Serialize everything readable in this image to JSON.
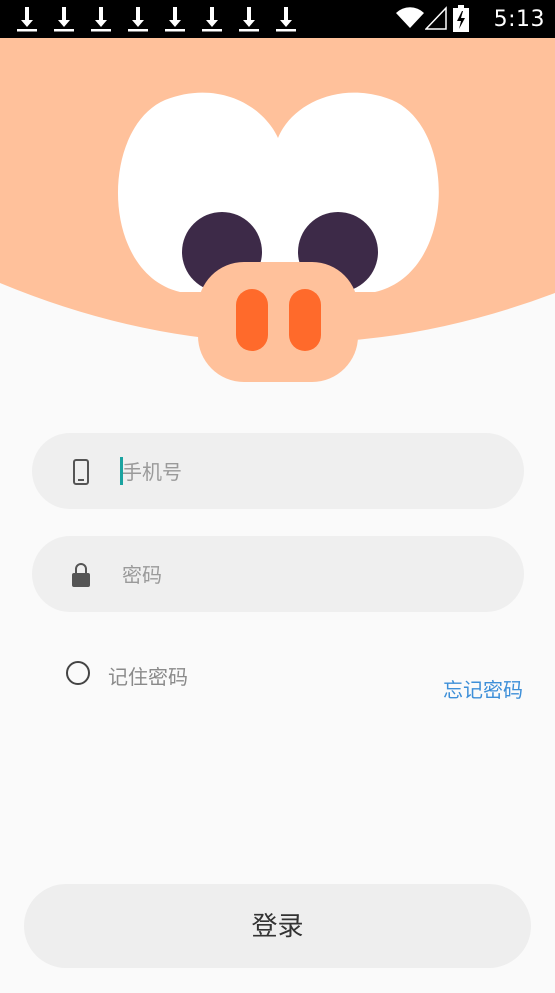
{
  "status_bar": {
    "time": "5:13",
    "download_icon_count": 8,
    "icons": [
      "download-icon",
      "wifi-icon",
      "signal-icon",
      "battery-icon"
    ]
  },
  "hero": {
    "icon": "pig-face-illustration",
    "colors": {
      "face": "#ffc19b",
      "eyes_white": "#ffffff",
      "pupil": "#3d2a48",
      "snout": "#ffc19b",
      "nostril": "#ff6a2b"
    }
  },
  "form": {
    "phone": {
      "icon": "phone-icon",
      "placeholder": "手机号",
      "value": ""
    },
    "password": {
      "icon": "lock-icon",
      "placeholder": "密码",
      "value": ""
    },
    "remember_label": "记住密码",
    "remember_checked": false,
    "forgot_label": "忘记密码",
    "login_label": "登录"
  },
  "colors": {
    "background": "#fafafa",
    "field_bg": "#efefef",
    "link": "#3d8fd8",
    "caret": "#1aa3a0"
  }
}
